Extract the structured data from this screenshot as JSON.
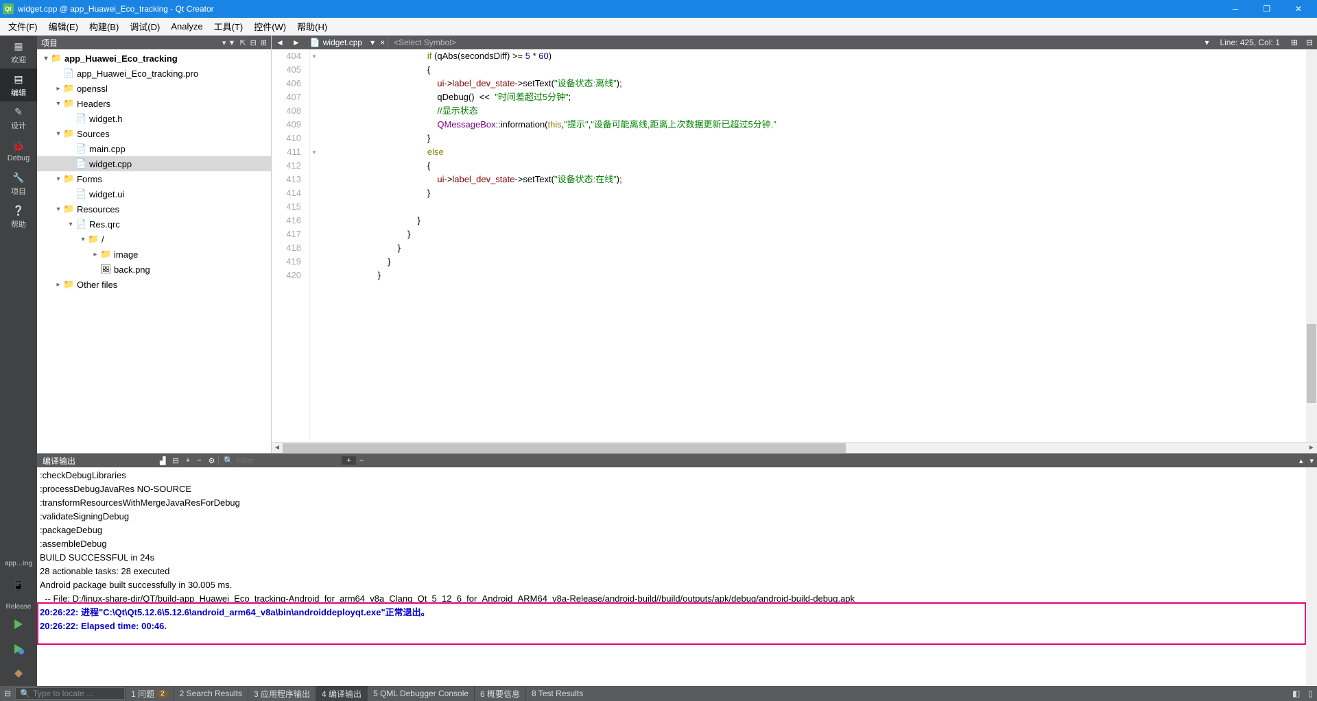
{
  "title": "widget.cpp @ app_Huawei_Eco_tracking - Qt Creator",
  "menubar": [
    "文件(F)",
    "编辑(E)",
    "构建(B)",
    "调试(D)",
    "Analyze",
    "工具(T)",
    "控件(W)",
    "帮助(H)"
  ],
  "modebar": {
    "items": [
      {
        "label": "欢迎",
        "icon": "▦"
      },
      {
        "label": "编辑",
        "icon": "▤",
        "active": true
      },
      {
        "label": "设计",
        "icon": "✎"
      },
      {
        "label": "Debug",
        "icon": "🐞"
      },
      {
        "label": "项目",
        "icon": "🔧"
      },
      {
        "label": "帮助",
        "icon": "❔"
      }
    ],
    "kit": "app…ing",
    "kit2": "Release"
  },
  "projectPanel": {
    "title": "项目"
  },
  "tree": [
    {
      "d": 0,
      "e": "▾",
      "i": "📁",
      "t": "app_Huawei_Eco_tracking",
      "bold": true
    },
    {
      "d": 1,
      "e": "",
      "i": "📄",
      "t": "app_Huawei_Eco_tracking.pro"
    },
    {
      "d": 1,
      "e": "▸",
      "i": "📁",
      "t": "openssl"
    },
    {
      "d": 1,
      "e": "▾",
      "i": "📁",
      "t": "Headers"
    },
    {
      "d": 2,
      "e": "",
      "i": "📄",
      "t": "widget.h"
    },
    {
      "d": 1,
      "e": "▾",
      "i": "📁",
      "t": "Sources"
    },
    {
      "d": 2,
      "e": "",
      "i": "📄",
      "t": "main.cpp"
    },
    {
      "d": 2,
      "e": "",
      "i": "📄",
      "t": "widget.cpp",
      "sel": true
    },
    {
      "d": 1,
      "e": "▾",
      "i": "📁",
      "t": "Forms"
    },
    {
      "d": 2,
      "e": "",
      "i": "📄",
      "t": "widget.ui"
    },
    {
      "d": 1,
      "e": "▾",
      "i": "📁",
      "t": "Resources"
    },
    {
      "d": 2,
      "e": "▾",
      "i": "📄",
      "t": "Res.qrc"
    },
    {
      "d": 3,
      "e": "▾",
      "i": "📁",
      "t": "/"
    },
    {
      "d": 4,
      "e": "▸",
      "i": "📁",
      "t": "image"
    },
    {
      "d": 4,
      "e": "",
      "i": "🖼",
      "t": "back.png"
    },
    {
      "d": 1,
      "e": "▸",
      "i": "📁",
      "t": "Other files"
    }
  ],
  "editor": {
    "file": "widget.cpp",
    "symbol": "<Select Symbol>",
    "position": "Line: 425, Col: 1",
    "gutter_start": 404,
    "lines": [
      {
        "n": 404,
        "fold": "▾",
        "html": "                                            <span class='kw'>if</span> (qAbs(secondsDiff) &gt;= <span class='num'>5</span> * <span class='num'>60</span>)"
      },
      {
        "n": 405,
        "html": "                                            {"
      },
      {
        "n": 406,
        "html": "                                                <span class='ptr'>ui</span>-&gt;<span class='mem'>label_dev_state</span>-&gt;setText(<span class='str'>\"设备状态:离线\"</span>);"
      },
      {
        "n": 407,
        "html": "                                                qDebug()  &lt;&lt;  <span class='str'>\"时间差超过5分钟\"</span>;"
      },
      {
        "n": 408,
        "html": "                                                <span class='cm'>//显示状态</span>"
      },
      {
        "n": 409,
        "html": "                                                <span class='ty'>QMessageBox</span>::information(<span class='kw'>this</span>,<span class='str'>\"提示\"</span>,<span class='str'>\"设备可能离线,距离上次数据更新已超过5分钟.\"</span>"
      },
      {
        "n": 410,
        "html": "                                            }"
      },
      {
        "n": 411,
        "fold": "▾",
        "html": "                                            <span class='kw'>else</span>"
      },
      {
        "n": 412,
        "html": "                                            {"
      },
      {
        "n": 413,
        "html": "                                                <span class='ptr'>ui</span>-&gt;<span class='mem'>label_dev_state</span>-&gt;setText(<span class='str'>\"设备状态:在线\"</span>);"
      },
      {
        "n": 414,
        "html": "                                            }"
      },
      {
        "n": 415,
        "html": ""
      },
      {
        "n": 416,
        "html": "                                        }"
      },
      {
        "n": 417,
        "html": "                                    }"
      },
      {
        "n": 418,
        "html": "                                }"
      },
      {
        "n": 419,
        "html": "                            }"
      },
      {
        "n": 420,
        "html": "                        }"
      }
    ]
  },
  "output": {
    "title": "编译输出",
    "filter_placeholder": "Filter",
    "lines": [
      {
        "t": ":checkDebugLibraries"
      },
      {
        "t": ":processDebugJavaRes NO-SOURCE"
      },
      {
        "t": ":transformResourcesWithMergeJavaResForDebug"
      },
      {
        "t": ":validateSigningDebug"
      },
      {
        "t": ":packageDebug"
      },
      {
        "t": ":assembleDebug"
      },
      {
        "t": ""
      },
      {
        "t": "BUILD SUCCESSFUL in 24s"
      },
      {
        "t": "28 actionable tasks: 28 executed"
      },
      {
        "t": "Android package built successfully in 30.005 ms."
      },
      {
        "t": "  -- File: D:/linux-share-dir/QT/build-app_Huawei_Eco_tracking-Android_for_arm64_v8a_Clang_Qt_5_12_6_for_Android_ARM64_v8a-Release/android-build//build/outputs/apk/debug/android-build-debug.apk"
      },
      {
        "t": "20:26:22: 进程\"C:\\Qt\\Qt5.12.6\\5.12.6\\android_arm64_v8a\\bin\\androiddeployqt.exe\"正常退出。",
        "cls": "blue"
      },
      {
        "t": "20:26:22: Elapsed time: 00:46.",
        "cls": "blue"
      }
    ]
  },
  "statusbar": {
    "locator_placeholder": "Type to locate ...",
    "buttons": [
      {
        "n": "1",
        "t": "问题",
        "badge": "2"
      },
      {
        "n": "2",
        "t": "Search Results"
      },
      {
        "n": "3",
        "t": "应用程序输出"
      },
      {
        "n": "4",
        "t": "编译输出",
        "active": true
      },
      {
        "n": "5",
        "t": "QML Debugger Console"
      },
      {
        "n": "6",
        "t": "概要信息"
      },
      {
        "n": "8",
        "t": "Test Results"
      }
    ]
  }
}
